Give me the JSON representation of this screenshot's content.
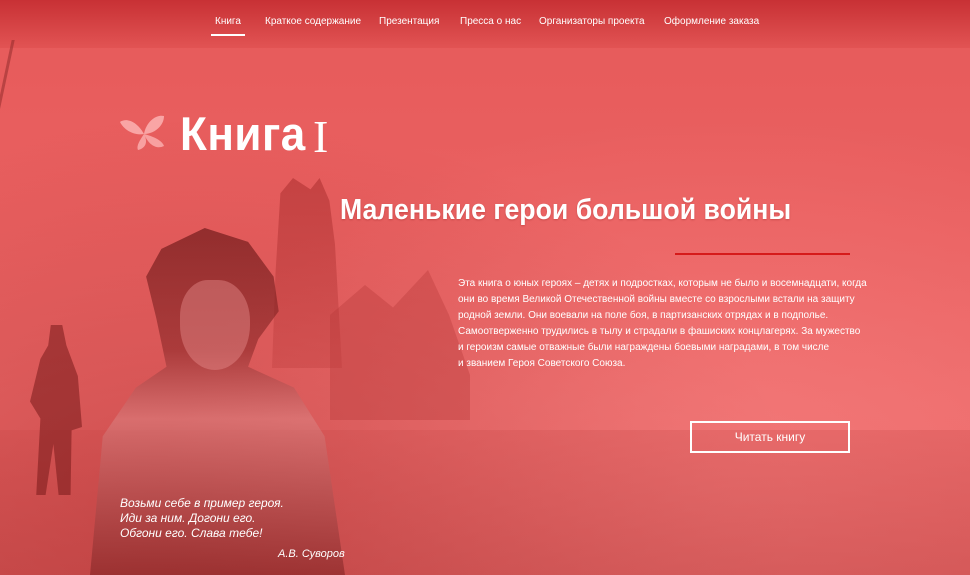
{
  "nav": {
    "items": [
      {
        "label": "Книга",
        "active": true
      },
      {
        "label": "Краткое содержание",
        "active": false
      },
      {
        "label": "Презентация",
        "active": false
      },
      {
        "label": "Пресса о нас",
        "active": false
      },
      {
        "label": "Организаторы проекта",
        "active": false
      },
      {
        "label": "Оформление заказа",
        "active": false
      }
    ]
  },
  "hero": {
    "logo_icon": "leaf-icon",
    "title": "Книга",
    "title_numeral": "I",
    "subtitle": "Маленькие герои большой войны",
    "accent_color": "#d61a1a",
    "description_lines": [
      "Эта книга о юных героях – детях и подростках, которым не было и восемнадцати, когда",
      "они во время Великой Отечественной войны вместе со взрослыми встали на защиту",
      "родной земли. Они воевали на поле боя, в партизанских отрядах и в подполье.",
      "Самоотверженно трудились в тылу и страдали в фашиских концлагерях. За мужество",
      "и героизм самые отважные были награждены боевыми наградами, в том числе",
      "и званием Героя Советского Союза."
    ],
    "read_button_label": "Читать книгу"
  },
  "quote": {
    "lines": [
      "Возьми себе в пример героя.",
      "Иди за ним. Догони его.",
      "Обгони его. Слава тебе!"
    ],
    "author": "А.В. Суворов"
  },
  "colors": {
    "background": "#e86262",
    "text": "#ffffff"
  }
}
